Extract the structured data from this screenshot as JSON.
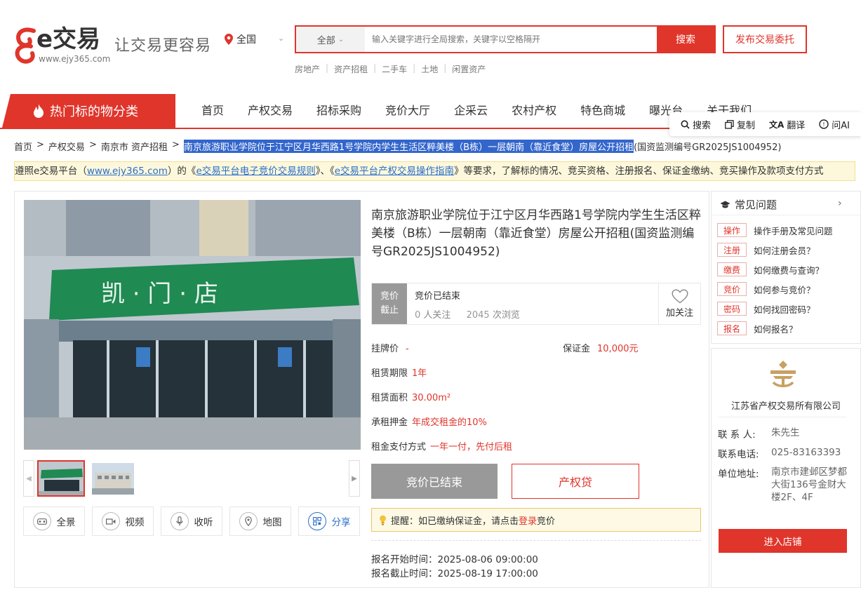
{
  "header": {
    "logo_text": "e交易",
    "logo_url": "www.ejy365.com",
    "slogan": "让交易更容易",
    "location": "全国",
    "search_category": "全部",
    "search_placeholder": "输入关键字进行全局搜索，关键字以空格隔开",
    "search_button": "搜索",
    "publish_button": "发布交易委托",
    "quick_links": [
      "房地产",
      "资产招租",
      "二手车",
      "土地",
      "闲置资产"
    ]
  },
  "nav": {
    "hot_category": "热门标的物分类",
    "items": [
      "首页",
      "产权交易",
      "招标采购",
      "竞价大厅",
      "企采云",
      "农村产权",
      "特色商城",
      "曝光台",
      "关于我们"
    ]
  },
  "float_tools": [
    "搜索",
    "复制",
    "翻译",
    "问AI"
  ],
  "breadcrumb": {
    "items": [
      "首页",
      "产权交易",
      "南京市 资产招租"
    ],
    "current_highlighted": "南京旅游职业学院位于江宁区月华西路1号学院内学生生活区粹美楼（B栋）一层朝南（靠近食堂）房屋公开招租",
    "current_rest": "(国资监测编号GR2025JS1004952)"
  },
  "notice": {
    "p1": "遵照e交易平台（",
    "link1": "www.ejy365.com",
    "p2": "）的《",
    "link2": "e交易平台电子竞价交易规则",
    "p3": "》、《",
    "link3": "e交易平台产权交易操作指南",
    "p4": "》等要求，了解标的情况、竞买资格、注册报名、保证金缴纳、竞买操作及款项支付方式"
  },
  "listing": {
    "title": "南京旅游职业学院位于江宁区月华西路1号学院内学生生活区粹美楼（B栋）一层朝南（靠近食堂）房屋公开招租(国资监测编号GR2025JS1004952)",
    "status_tag_1": "竞价",
    "status_tag_2": "截止",
    "status_text": "竞价已结束",
    "followers": "0",
    "followers_label": "人关注",
    "views": "2045",
    "views_label": "次浏览",
    "follow_label": "加关注",
    "listing_price_label": "挂牌价",
    "listing_price": "-",
    "deposit_label": "保证金",
    "deposit": "10,000元",
    "lease_term_label": "租赁期限",
    "lease_term": "1年",
    "area_label": "租赁面积",
    "area": "30.00m²",
    "lease_deposit_label": "承租押金",
    "lease_deposit": "年成交租金的10%",
    "payment_label": "租金支付方式",
    "payment": "一年一付，先付后租",
    "btn_ended": "竞价已结束",
    "btn_loan": "产权贷",
    "tip_prefix": "提醒：如已缴纳保证金，请点击",
    "tip_login": "登录",
    "tip_suffix": "竞价",
    "signup_start": "报名开始时间：2025-08-06 09:00:00",
    "signup_end": "报名截止时间：2025-08-19 17:00:00",
    "sign_text": "凯 · 门 · 店"
  },
  "media_tools": [
    "全景",
    "视频",
    "收听",
    "地图",
    "分享"
  ],
  "faq": {
    "title": "常见问题",
    "items": [
      {
        "tag": "操作",
        "text": "操作手册及常见问题"
      },
      {
        "tag": "注册",
        "text": "如何注册会员？"
      },
      {
        "tag": "缴费",
        "text": "如何缴费与查询？"
      },
      {
        "tag": "竞价",
        "text": "如何参与竞价？"
      },
      {
        "tag": "密码",
        "text": "如何找回密码？"
      },
      {
        "tag": "报名",
        "text": "如何报名？"
      }
    ]
  },
  "org": {
    "name": "江苏省产权交易所有限公司",
    "contact_label": "联 系 人:",
    "contact": "朱先生",
    "phone_label": "联系电话:",
    "phone": "025-83163393",
    "address_label": "单位地址:",
    "address": "南京市建邺区梦都大街136号金财大楼2F、4F",
    "shop_button": "进入店铺"
  },
  "colors": {
    "accent": "#e0352b",
    "link": "#2a6fc9",
    "disabled": "#999999"
  }
}
